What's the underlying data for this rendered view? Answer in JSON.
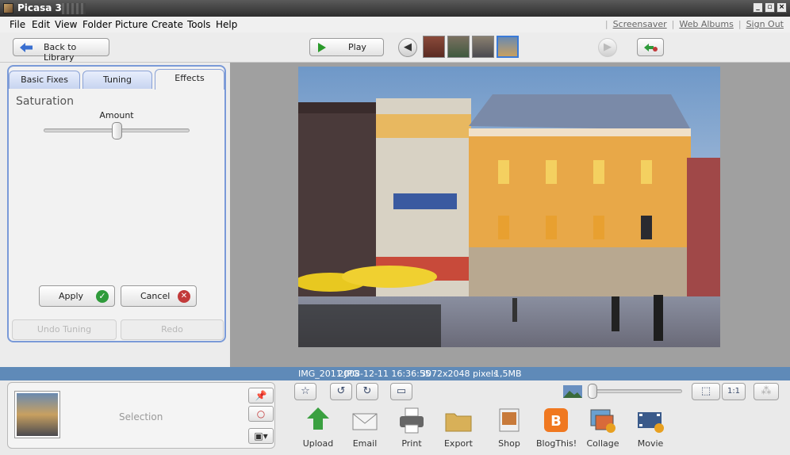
{
  "window": {
    "title": "Picasa 3"
  },
  "menu": [
    "File",
    "Edit",
    "View",
    "Folder",
    "Picture",
    "Create",
    "Tools",
    "Help"
  ],
  "top_links": [
    "Screensaver",
    "Web Albums",
    "Sign Out"
  ],
  "toolbar": {
    "back_label": "Back to Library",
    "play_label": "Play"
  },
  "tabs": [
    {
      "label": "Basic Fixes",
      "active": false
    },
    {
      "label": "Tuning",
      "active": false
    },
    {
      "label": "Effects",
      "active": true
    }
  ],
  "effect_panel": {
    "title": "Saturation",
    "amount_label": "Amount",
    "amount_value": 0.5,
    "apply_label": "Apply",
    "cancel_label": "Cancel",
    "undo_label": "Undo Tuning",
    "redo_label": "Redo"
  },
  "info": {
    "filename": "IMG_2011.JPG",
    "datetime": "2008-12-11 16:36:55",
    "dimensions": "3072x2048 pixels",
    "size": "1,5MB"
  },
  "tray": {
    "selection_label": "Selection"
  },
  "actions": [
    "Upload",
    "Email",
    "Print",
    "Export",
    "Shop",
    "BlogThis!",
    "Collage",
    "Movie"
  ],
  "zoom": {
    "fit_label": "",
    "one_to_one_label": "1:1"
  },
  "colors": {
    "accent": "#5f8ab8",
    "tab_border": "#7a9ad8"
  }
}
